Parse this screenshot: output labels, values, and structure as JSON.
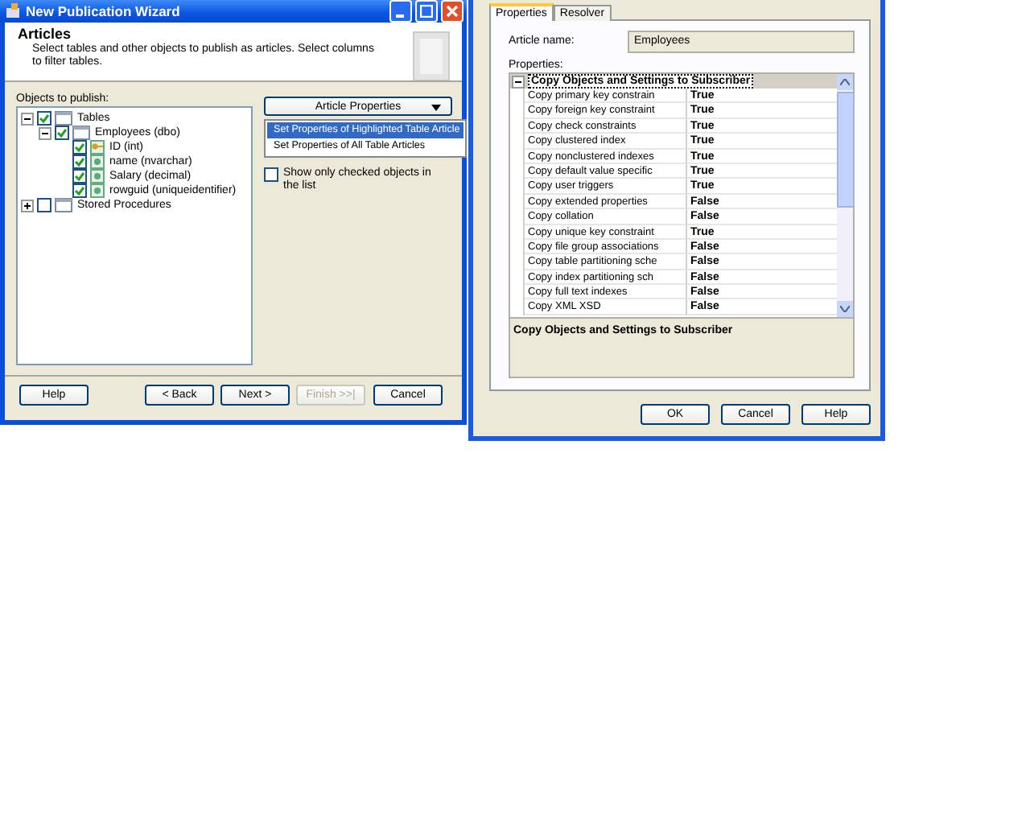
{
  "wizard": {
    "title": "New Publication Wizard",
    "header": {
      "title": "Articles",
      "description": "Select tables and other objects to publish as articles. Select columns to filter tables."
    },
    "objects_label": "Objects to publish:",
    "tree": [
      {
        "label": "Tables",
        "kind": "folder",
        "checked": true,
        "expanded": true,
        "children": [
          {
            "label": "Employees (dbo)",
            "kind": "table",
            "checked": true,
            "expanded": true,
            "children": [
              {
                "label": "ID (int)",
                "kind": "key-column",
                "checked": true
              },
              {
                "label": "name (nvarchar)",
                "kind": "column",
                "checked": true
              },
              {
                "label": "Salary (decimal)",
                "kind": "column",
                "checked": true
              },
              {
                "label": "rowguid (uniqueidentifier)",
                "kind": "column",
                "checked": true
              }
            ]
          }
        ]
      },
      {
        "label": "Stored Procedures",
        "kind": "folder",
        "checked": false,
        "expanded": false
      }
    ],
    "article_properties": {
      "label": "Article Properties",
      "menu": [
        {
          "label": "Set Properties of Highlighted Table Article",
          "selected": true
        },
        {
          "label": "Set Properties of All Table Articles",
          "selected": false
        }
      ]
    },
    "show_checked": {
      "label": "Show only checked objects in the list",
      "checked": false
    },
    "buttons": [
      {
        "label": "Help",
        "disabled": false
      },
      {
        "label": "< Back",
        "disabled": false
      },
      {
        "label": "Next >",
        "disabled": false
      },
      {
        "label": "Finish >>|",
        "disabled": true
      },
      {
        "label": "Cancel",
        "disabled": false
      }
    ]
  },
  "properties_dialog": {
    "tabs": [
      {
        "label": "Properties",
        "selected": true
      },
      {
        "label": "Resolver",
        "selected": false
      }
    ],
    "article_name_label": "Article name:",
    "article_name": "Employees",
    "properties_label": "Properties:",
    "category": {
      "label": "Copy Objects and Settings to Subscriber",
      "expanded": true
    },
    "rows": [
      {
        "name": "Copy primary key constrain",
        "value": "True"
      },
      {
        "name": "Copy foreign key constraint",
        "value": "True"
      },
      {
        "name": "Copy check constraints",
        "value": "True"
      },
      {
        "name": "Copy clustered index",
        "value": "True"
      },
      {
        "name": "Copy nonclustered indexes",
        "value": "True"
      },
      {
        "name": "Copy default value specific",
        "value": "True"
      },
      {
        "name": "Copy user triggers",
        "value": "True"
      },
      {
        "name": "Copy extended properties",
        "value": "False"
      },
      {
        "name": "Copy collation",
        "value": "False"
      },
      {
        "name": "Copy unique key constraint",
        "value": "True"
      },
      {
        "name": "Copy file group associations",
        "value": "False"
      },
      {
        "name": "Copy table partitioning sche",
        "value": "False"
      },
      {
        "name": "Copy index partitioning sch",
        "value": "False"
      },
      {
        "name": "Copy full text indexes",
        "value": "False"
      },
      {
        "name": "Copy XML XSD",
        "value": "False"
      }
    ],
    "description": "Copy Objects and Settings to Subscriber",
    "buttons": [
      "OK",
      "Cancel",
      "Help"
    ]
  }
}
